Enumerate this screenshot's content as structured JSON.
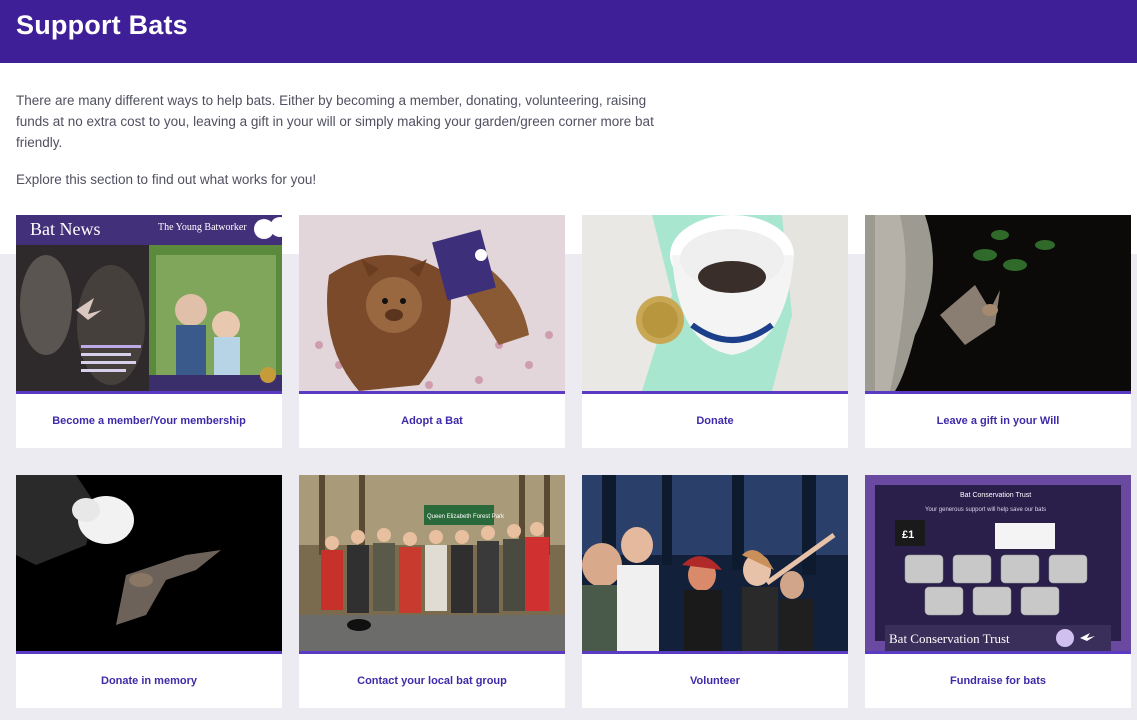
{
  "header": {
    "title": "Support Bats"
  },
  "intro": {
    "paragraph1": "There are many different ways to help bats. Either by becoming a member, donating, volunteering, raising funds at no extra cost to you, leaving a gift in your will or simply making your garden/green corner more bat friendly.",
    "paragraph2": "Explore this section to find out what works for you!"
  },
  "cards": [
    {
      "label": "Become a member/Your membership",
      "image": "magazine-covers-image",
      "image_text": {
        "left_title": "Bat News",
        "right_title": "The Young Batworker",
        "brand": "Bat Conservation Trust"
      }
    },
    {
      "label": "Adopt a Bat",
      "image": "plush-bat-toy-image"
    },
    {
      "label": "Donate",
      "image": "bat-in-cup-with-coin-image"
    },
    {
      "label": "Leave a gift in your Will",
      "image": "bat-flying-by-tree-image"
    },
    {
      "label": "Donate in memory",
      "image": "bat-leaving-gloved-hand-image"
    },
    {
      "label": "Contact your local bat group",
      "image": "bat-group-photo-image",
      "image_text": {
        "sign": "Queen Elizabeth Forest Park"
      }
    },
    {
      "label": "Volunteer",
      "image": "volunteers-at-night-image"
    },
    {
      "label": "Fundraise for bats",
      "image": "bat-badge-collection-box-image",
      "image_text": {
        "box_title": "Bat Conservation Trust",
        "box_tagline": "Your generous support will help save our bats",
        "price": "£1"
      }
    }
  ],
  "colors": {
    "header_bg": "#3f1f97",
    "accent_bar": "#5b3bc4",
    "label_text": "#3f2aa8",
    "band_bg": "#ecebf2"
  }
}
